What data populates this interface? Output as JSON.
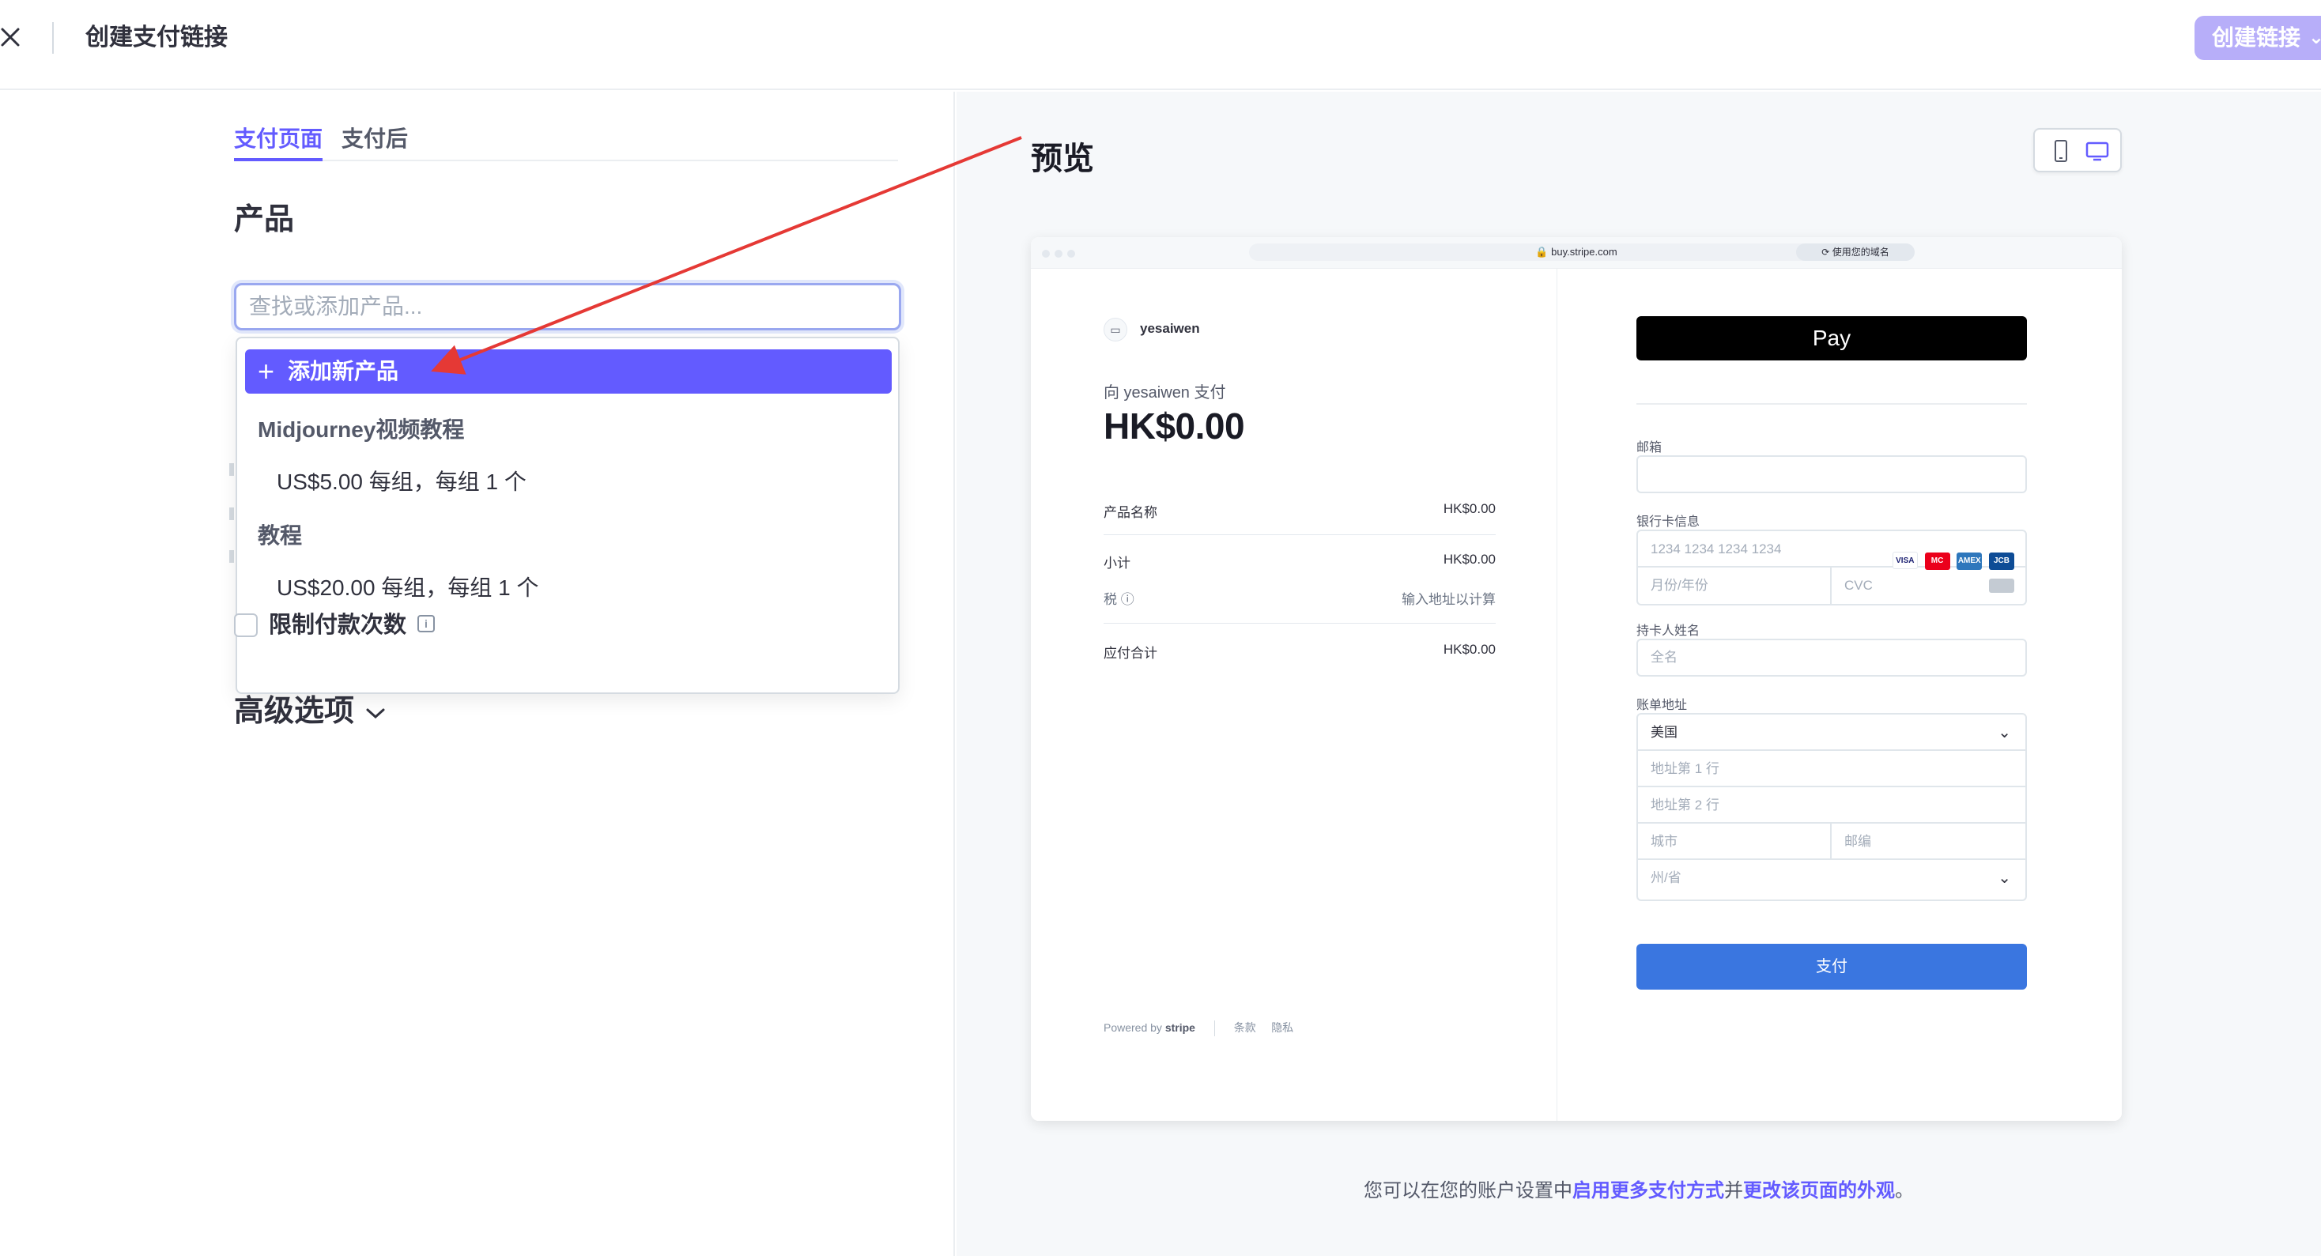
{
  "header": {
    "title": "创建支付链接",
    "create_button": "创建链接"
  },
  "left": {
    "tabs": [
      {
        "label": "支付页面",
        "active": true
      },
      {
        "label": "支付后",
        "active": false
      }
    ],
    "section_title": "产品",
    "search": {
      "placeholder": "查找或添加产品...",
      "value": ""
    },
    "dropdown": {
      "add_new": "添加新产品",
      "products": [
        {
          "name": "Midjourney视频教程",
          "price": "US$5.00 每组，每组 1 个"
        },
        {
          "name": "教程",
          "price": "US$20.00 每组，每组 1 个"
        }
      ]
    },
    "limit_payments": {
      "label": "限制付款次数",
      "checked": false
    },
    "advanced": "高级选项"
  },
  "preview": {
    "title": "预览",
    "url": "buy.stripe.com",
    "domain_pill": "使用您的域名",
    "merchant": "yesaiwen",
    "pay_to": "向 yesaiwen 支付",
    "amount": "HK$0.00",
    "lines": [
      {
        "label": "产品名称",
        "value": "HK$0.00"
      },
      {
        "label": "小计",
        "value": "HK$0.00"
      },
      {
        "label": "税 ⓘ",
        "value": "输入地址以计算"
      },
      {
        "label": "应付合计",
        "value": "HK$0.00"
      }
    ],
    "footer": {
      "powered": "Powered by",
      "brand": "stripe",
      "terms": "条款",
      "privacy": "隐私"
    },
    "applepay": " Pay",
    "form": {
      "email_label": "邮箱",
      "card_label": "银行卡信息",
      "card_number_placeholder": "1234 1234 1234 1234",
      "expiry_placeholder": "月份/年份",
      "cvc_placeholder": "CVC",
      "name_label": "持卡人姓名",
      "name_placeholder": "全名",
      "address_label": "账单地址",
      "country": "美国",
      "address1_placeholder": "地址第 1 行",
      "address2_placeholder": "地址第 2 行",
      "city_placeholder": "城市",
      "zip_placeholder": "邮编",
      "state_placeholder": "州/省",
      "pay_button": "支付",
      "card_brands": [
        "VISA",
        "MC",
        "AMEX",
        "JCB"
      ]
    }
  },
  "bottom_note": {
    "prefix": "您可以在您的账户设置中",
    "link1": "启用更多支付方式",
    "mid": "并",
    "link2": "更改该页面的外观",
    "suffix": "。"
  },
  "colors": {
    "accent": "#635bff",
    "pay_button": "#3a76e0",
    "annotation_arrow": "#e53935"
  }
}
